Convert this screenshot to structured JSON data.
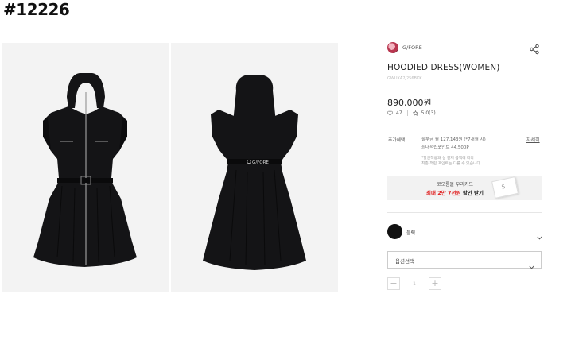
{
  "page_tag": "#12226",
  "brand": {
    "name": "G/FORE",
    "belt_logo_text": "G/FORE"
  },
  "product": {
    "title": "HOODIED DRESS(WOMEN)",
    "code": "GWUXA2J256BKK",
    "price": "890,000원",
    "wishlist_count": "47",
    "rating": "5.0(3)"
  },
  "points": {
    "label": "추가혜택",
    "line1": "할부금 월 127,143원 (*7개월 시)",
    "line2": "최대적립포인트 44,500P",
    "note1": "*할인적용과 실 결제 금액에 따라",
    "note2": "최종 적립 포인트는 다를 수 있습니다.",
    "detail_link": "자세히"
  },
  "banner": {
    "line1": "코오롱몰 우리카드",
    "highlight": "최대 2만 7천원",
    "suffix": " 할인 받기"
  },
  "color_option": {
    "label": "블랙",
    "swatch": "#111111"
  },
  "option_select": {
    "placeholder": "옵션선택"
  },
  "quantity": {
    "minus": "−",
    "value": "1",
    "plus": "+"
  },
  "icons": {
    "share": "share-icon",
    "heart": "heart-icon",
    "star": "star-icon",
    "chevron": "chevron-down-icon"
  },
  "colors": {
    "accent_red": "#e02020",
    "dress": "#141416",
    "photo_bg": "#f3f3f3"
  }
}
